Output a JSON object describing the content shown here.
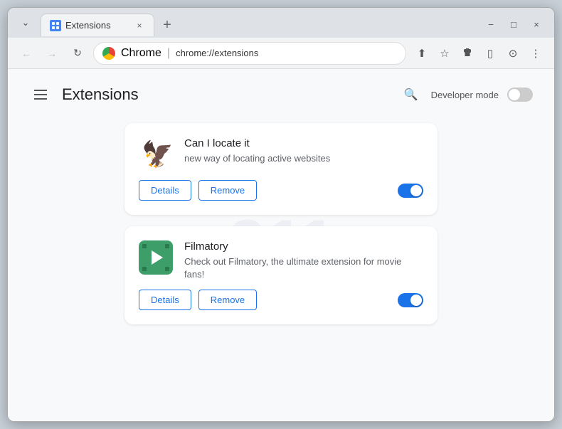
{
  "window": {
    "title": "Extensions",
    "tab_label": "Extensions",
    "tab_close": "×",
    "new_tab": "+",
    "controls": {
      "minimize": "−",
      "maximize": "□",
      "close": "×",
      "down_arrow": "⌄"
    }
  },
  "nav": {
    "back": "←",
    "forward": "→",
    "refresh": "↻",
    "address_brand": "Chrome",
    "address_separator": "|",
    "address_url": "chrome://extensions",
    "share": "⬆",
    "star": "☆",
    "puzzle": "⊞",
    "sidebar": "▯",
    "profile": "⊙",
    "menu": "⋮"
  },
  "page": {
    "title": "Extensions",
    "hamburger_label": "menu",
    "search_label": "search",
    "developer_mode_label": "Developer mode",
    "developer_mode_on": false
  },
  "extensions": [
    {
      "id": "can-i-locate-it",
      "name": "Can I locate it",
      "description": "new way of locating active websites",
      "enabled": true,
      "details_label": "Details",
      "remove_label": "Remove"
    },
    {
      "id": "filmatory",
      "name": "Filmatory",
      "description": "Check out Filmatory, the ultimate extension for movie fans!",
      "enabled": true,
      "details_label": "Details",
      "remove_label": "Remove"
    }
  ]
}
